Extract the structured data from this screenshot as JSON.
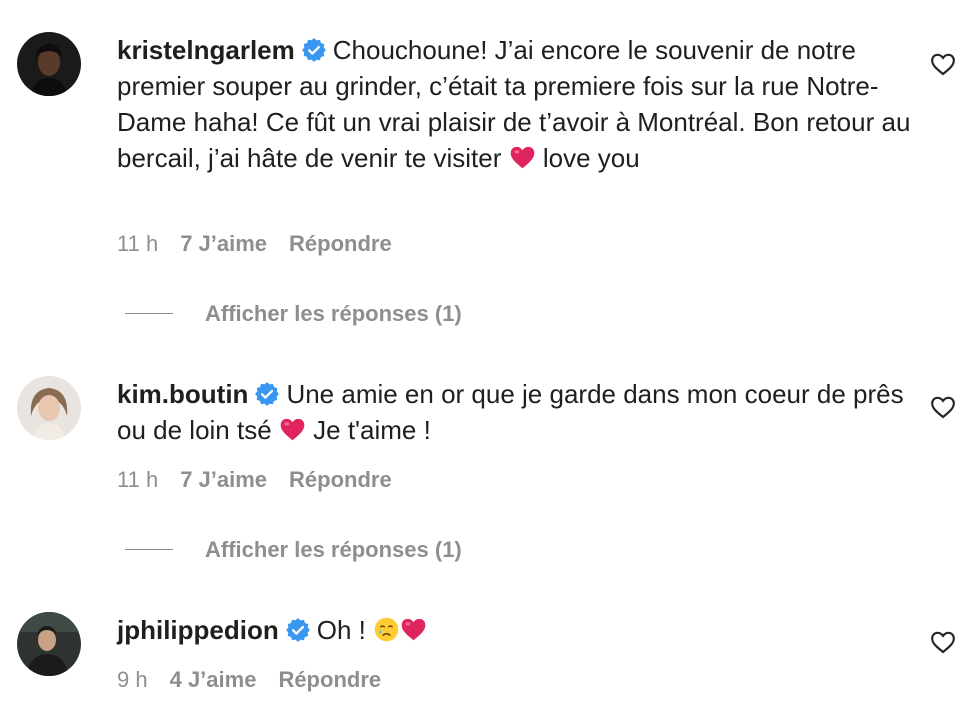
{
  "comments": [
    {
      "username": "kristelngarlem",
      "verified": true,
      "text_1": "Chouchoune! J’ai encore le souvenir de notre premier souper au grinder, c’était ta premiere fois sur la rue Notre-Dame haha! Ce fût un vrai plaisir de t’avoir à Montréal. Bon retour au bercail, j’ai hâte de venir te visiter",
      "text_2": "love you",
      "time": "11 h",
      "likes": "7 J’aime",
      "reply": "Répondre",
      "view_replies": "Afficher les réponses (1)"
    },
    {
      "username": "kim.boutin",
      "verified": true,
      "text_1": "Une amie en or que je garde dans mon coeur de prês ou de loin tsé",
      "text_2": "Je t'aime !",
      "time": "11 h",
      "likes": "7 J’aime",
      "reply": "Répondre",
      "view_replies": "Afficher les réponses (1)"
    },
    {
      "username": "jphilippedion",
      "verified": true,
      "text_1": "Oh !",
      "time": "9 h",
      "likes": "4 J’aime",
      "reply": "Répondre"
    }
  ],
  "icons": {
    "verified": "verified-badge-icon",
    "like": "heart-outline-icon",
    "heart_emoji": "red-heart-emoji",
    "cry_emoji": "crying-face-emoji"
  },
  "colors": {
    "verified_blue": "#3897f0",
    "meta_gray": "#8e8e8e",
    "text": "#1f1f1f",
    "heart_red": "#e0245e"
  }
}
